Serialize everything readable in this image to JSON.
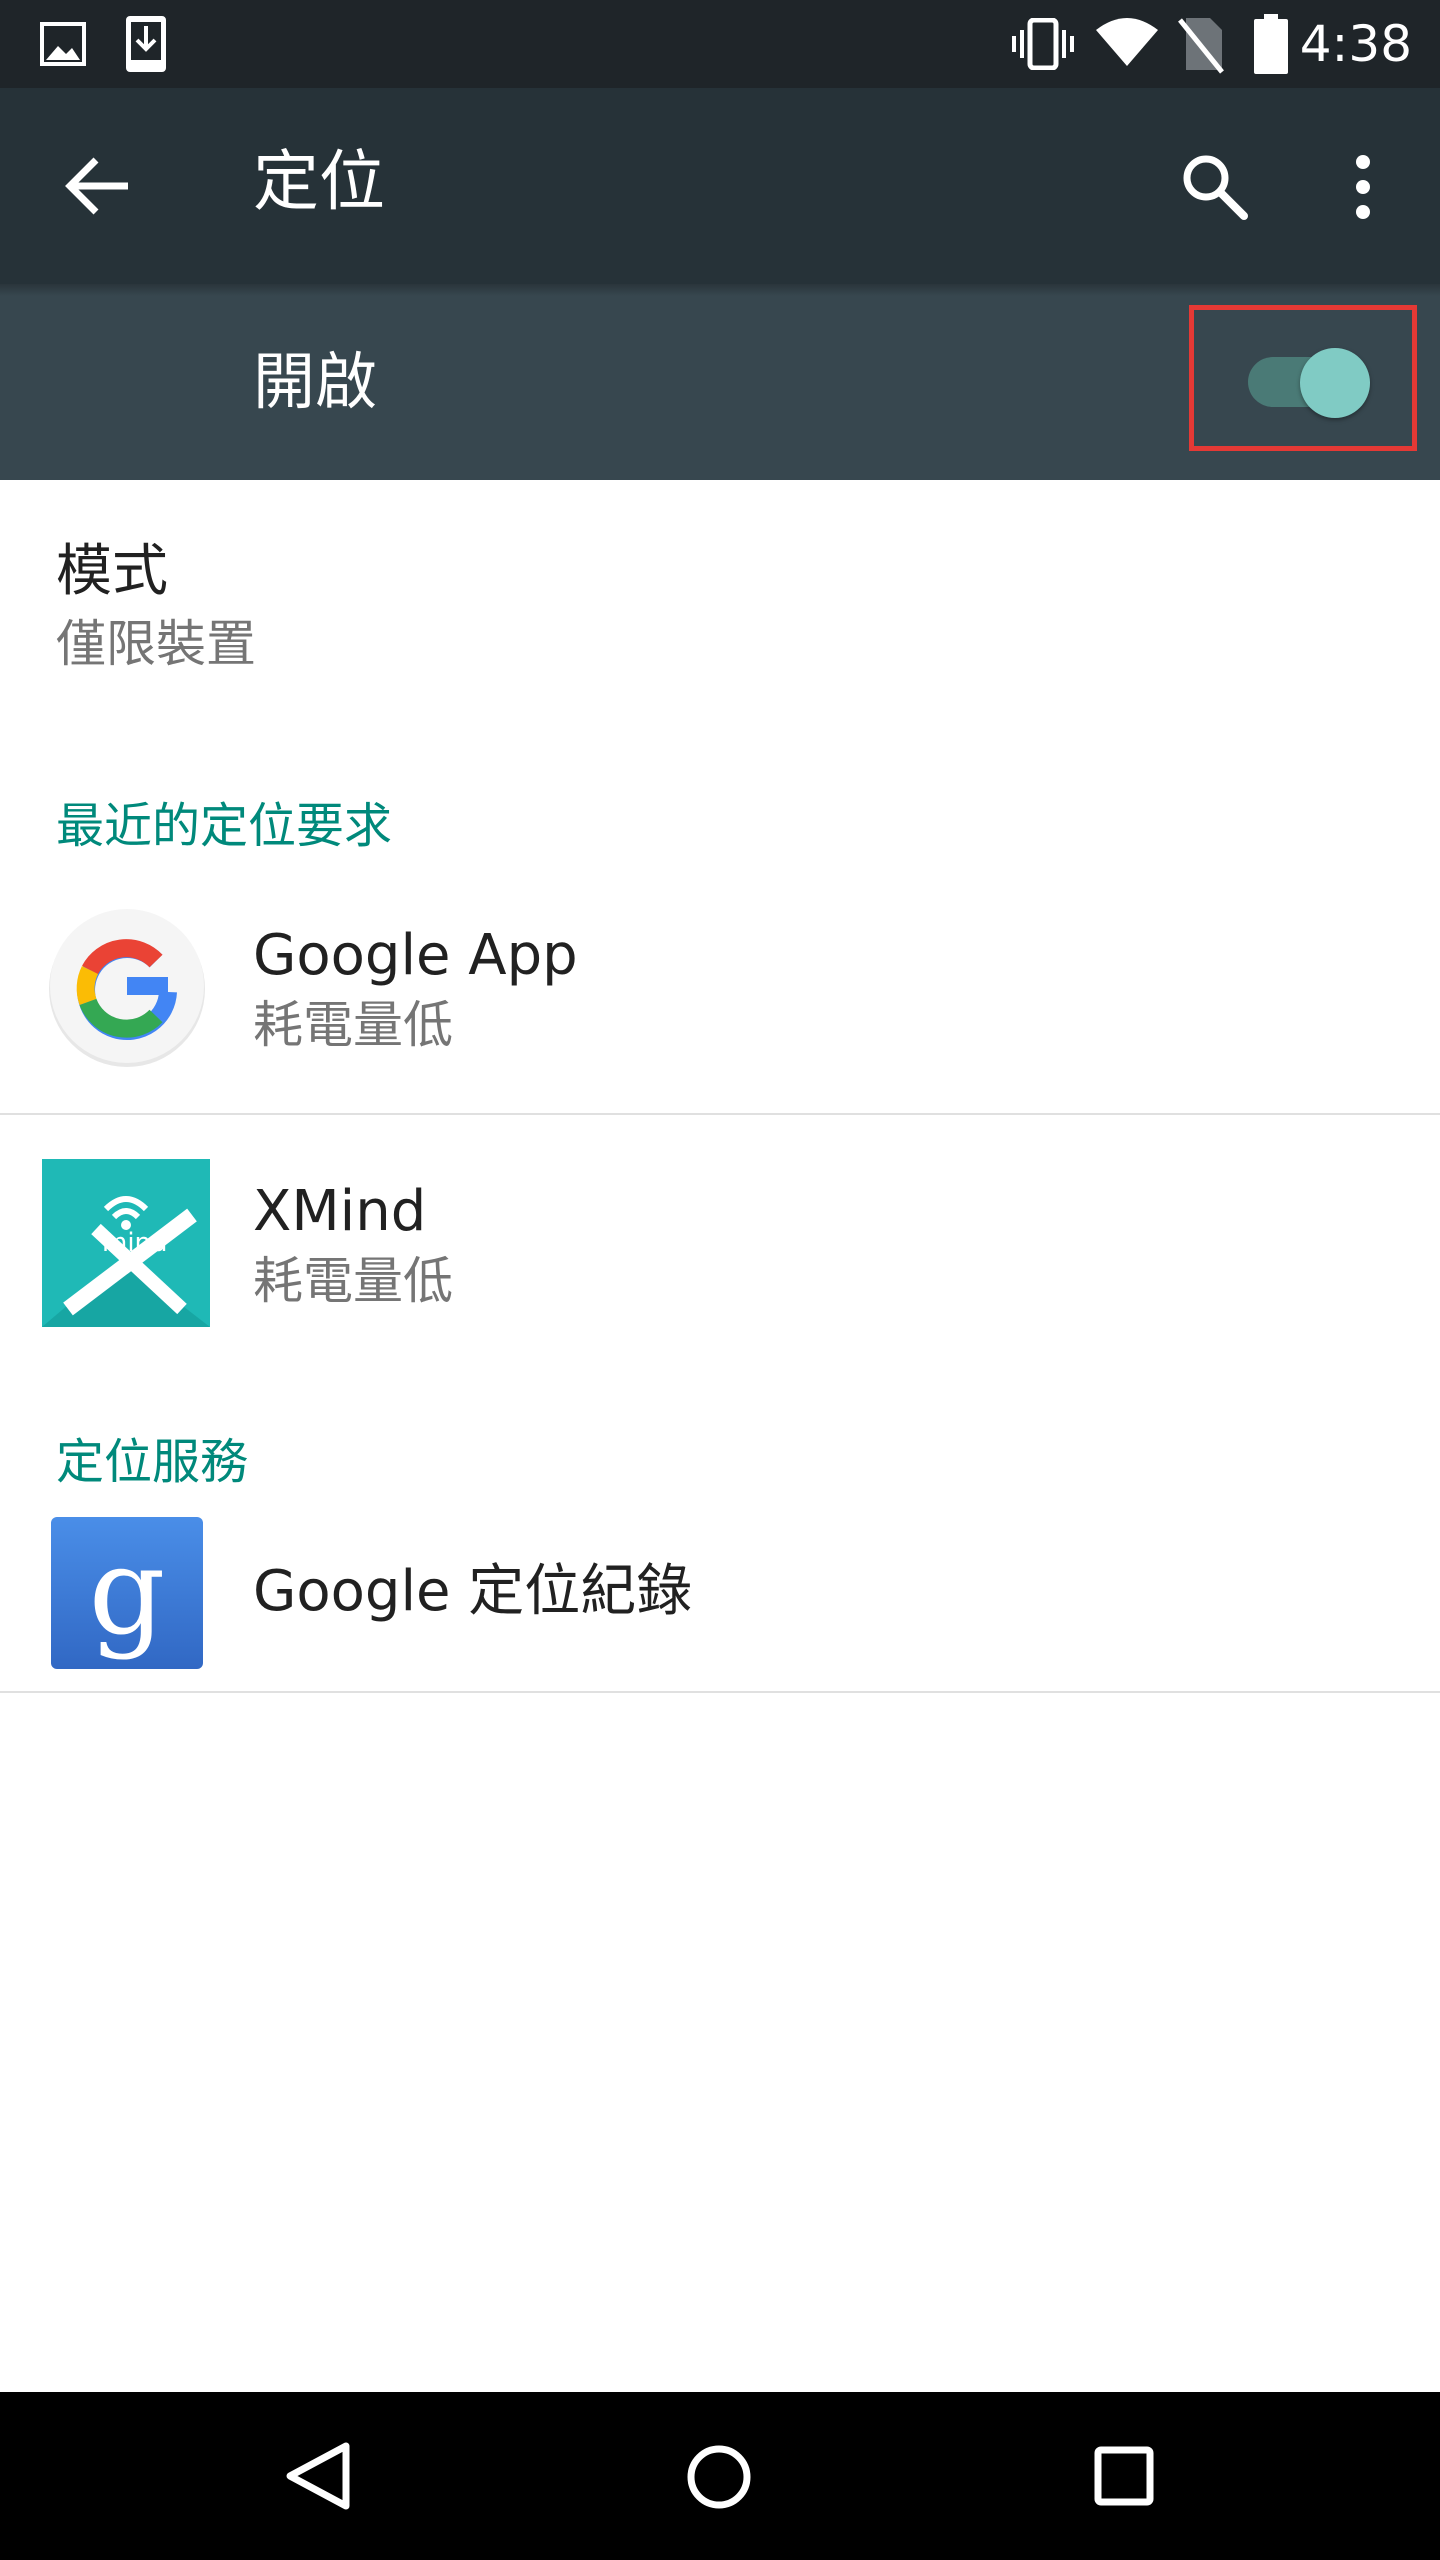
{
  "status_bar": {
    "time": "4:38",
    "left_icons": [
      "image-notification-icon",
      "download-notification-icon"
    ],
    "right_icons": [
      "vibrate-icon",
      "wifi-icon",
      "no-sim-icon",
      "battery-icon"
    ]
  },
  "app_bar": {
    "title": "定位",
    "icons": [
      "back-arrow-icon",
      "search-icon",
      "more-vert-icon"
    ]
  },
  "master_switch": {
    "label": "開啟",
    "state": "on",
    "colors": {
      "track": "#4a7a76",
      "thumb": "#80cbc4",
      "highlight_border": "#e53935"
    }
  },
  "mode": {
    "title": "模式",
    "value": "僅限裝置"
  },
  "recent_requests": {
    "header": "最近的定位要求",
    "items": [
      {
        "name": "Google App",
        "detail": "耗電量低",
        "icon": "google-app-icon"
      },
      {
        "name": "XMind",
        "detail": "耗電量低",
        "icon": "xmind-app-icon",
        "icon_text": "mind"
      }
    ]
  },
  "location_services": {
    "header": "定位服務",
    "items": [
      {
        "name": "Google 定位紀錄",
        "icon": "google-location-history-icon",
        "icon_text": "g"
      }
    ]
  },
  "nav_bar": {
    "icons": [
      "back-nav-icon",
      "home-nav-icon",
      "recents-nav-icon"
    ]
  },
  "theme": {
    "status_bar": "#1f2529",
    "app_bar": "#263238",
    "switch_bar": "#37474f",
    "accent": "#00897b"
  }
}
